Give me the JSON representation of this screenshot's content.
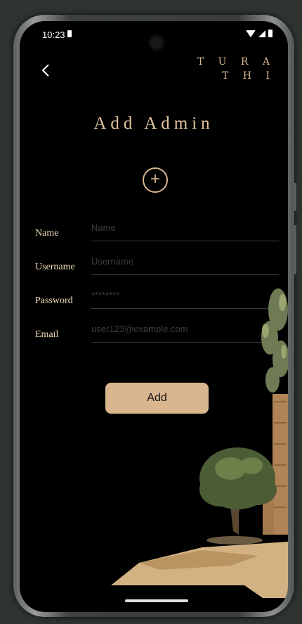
{
  "status_bar": {
    "time": "10:23"
  },
  "header": {
    "logo_line1": "T U R A",
    "logo_line2": "T H I"
  },
  "page": {
    "title": "Add Admin"
  },
  "form": {
    "fields": [
      {
        "label": "Name",
        "placeholder": "Name"
      },
      {
        "label": "Username",
        "placeholder": "Username"
      },
      {
        "label": "Password",
        "placeholder": "********"
      },
      {
        "label": "Email",
        "placeholder": "user123@example.com"
      }
    ],
    "submit_label": "Add"
  },
  "colors": {
    "accent": "#d9b68e",
    "label": "#f1d8b8",
    "background": "#000000"
  },
  "icons": {
    "back": "chevron-left-icon",
    "add_photo": "plus-circle-icon"
  }
}
